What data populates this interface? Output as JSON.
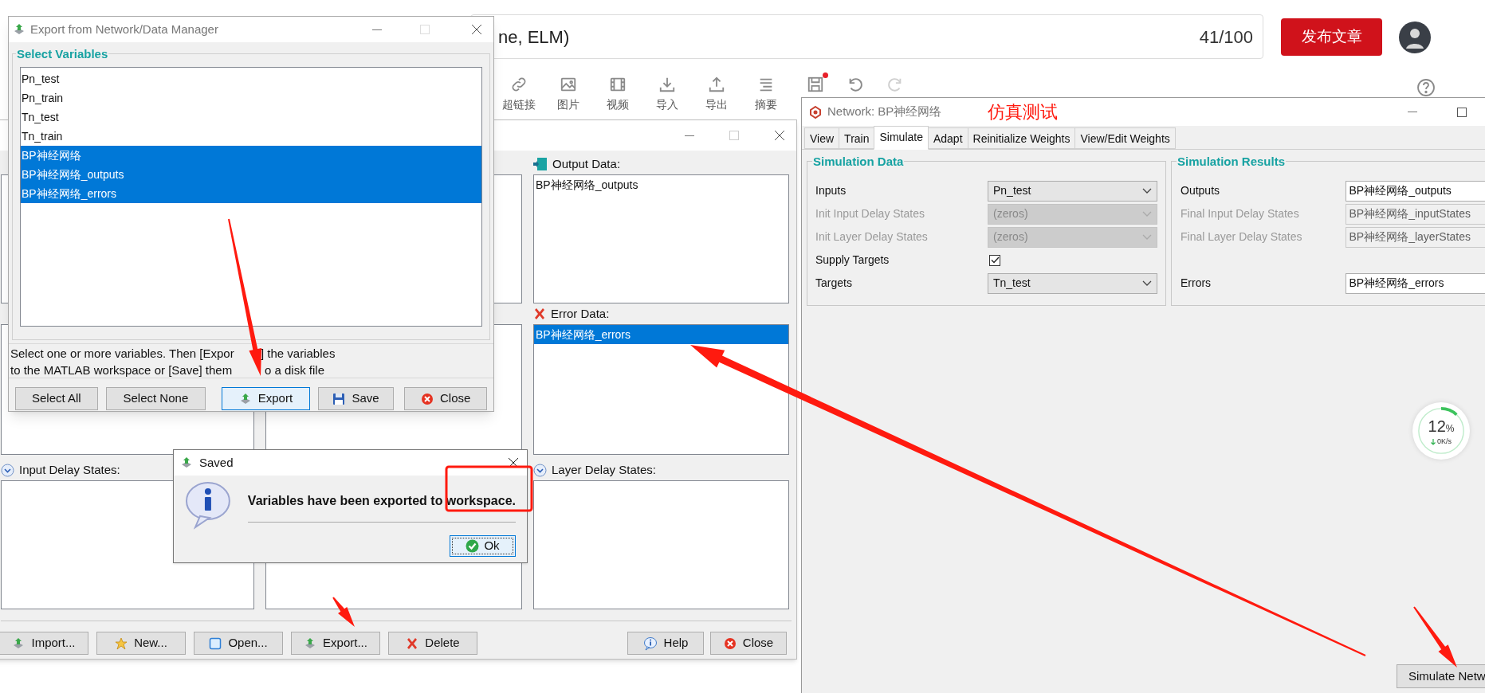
{
  "editor": {
    "title_text": "ne, ELM)",
    "counter": "41/100",
    "publish_button": "发布文章",
    "toolbar": [
      {
        "label": "超链接",
        "kind": "link"
      },
      {
        "label": "图片",
        "kind": "image"
      },
      {
        "label": "视频",
        "kind": "video"
      },
      {
        "label": "导入",
        "kind": "import"
      },
      {
        "label": "导出",
        "kind": "export"
      },
      {
        "label": "摘要",
        "kind": "summary"
      }
    ]
  },
  "manager": {
    "output_data": {
      "label": "Output Data:",
      "items": [
        {
          "text": "BP神经网络_outputs",
          "selected": false
        }
      ]
    },
    "error_data": {
      "label": "Error Data:",
      "items": [
        {
          "text": "BP神经网络_errors",
          "selected": true
        }
      ]
    },
    "input_delay_label": "Input Delay States:",
    "layer_delay_label": "Layer Delay States:",
    "buttons_left": [
      {
        "label": "Import...",
        "kind": "import"
      },
      {
        "label": "New...",
        "kind": "new"
      },
      {
        "label": "Open...",
        "kind": "open"
      },
      {
        "label": "Export...",
        "kind": "export"
      },
      {
        "label": "Delete",
        "kind": "delete"
      }
    ],
    "buttons_right": [
      {
        "label": "Help",
        "kind": "help"
      },
      {
        "label": "Close",
        "kind": "close"
      }
    ]
  },
  "export_dialog": {
    "title": "Export from Network/Data Manager",
    "group_title": "Select Variables",
    "variables": [
      {
        "name": "Pn_test",
        "selected": false
      },
      {
        "name": "Pn_train",
        "selected": false
      },
      {
        "name": "Tn_test",
        "selected": false
      },
      {
        "name": "Tn_train",
        "selected": false
      },
      {
        "name": "BP神经网络",
        "selected": true
      },
      {
        "name": "BP神经网络_outputs",
        "selected": true
      },
      {
        "name": "BP神经网络_errors",
        "selected": true
      }
    ],
    "hint_lines": [
      [
        "Select one or more variables. Then [Expor",
        "] the variables"
      ],
      [
        "to the MATLAB workspace or [Save] them",
        "o a disk file"
      ]
    ],
    "buttons": [
      {
        "label": "Select All",
        "kind": "plain",
        "focused": false
      },
      {
        "label": "Select None",
        "kind": "plain",
        "focused": false
      },
      {
        "label": "Export",
        "kind": "export",
        "focused": true
      },
      {
        "label": "Save",
        "kind": "save",
        "focused": false
      },
      {
        "label": "Close",
        "kind": "close",
        "focused": false
      }
    ]
  },
  "saved_dialog": {
    "title": "Saved",
    "message": "Variables have been exported to workspace.",
    "ok_button": "Ok"
  },
  "network_window": {
    "title": "Network: BP神经网络",
    "tabs": [
      {
        "label": "View",
        "selected": false
      },
      {
        "label": "Train",
        "selected": false
      },
      {
        "label": "Simulate",
        "selected": true
      },
      {
        "label": "Adapt",
        "selected": false
      },
      {
        "label": "Reinitialize Weights",
        "selected": false
      },
      {
        "label": "View/Edit Weights",
        "selected": false
      }
    ],
    "simulation_data": {
      "title": "Simulation Data",
      "rows": [
        {
          "kind": "combo",
          "label": "Inputs",
          "value": "Pn_test",
          "disabled": false
        },
        {
          "kind": "combo",
          "label": "Init Input Delay States",
          "value": "(zeros)",
          "disabled": true
        },
        {
          "kind": "combo",
          "label": "Init Layer Delay States",
          "value": "(zeros)",
          "disabled": true
        },
        {
          "kind": "checkbox",
          "label": "Supply Targets",
          "checked": true
        },
        {
          "kind": "combo",
          "label": "Targets",
          "value": "Tn_test",
          "disabled": false
        }
      ]
    },
    "simulation_results": {
      "title": "Simulation Results",
      "rows": [
        {
          "kind": "field",
          "label": "Outputs",
          "value": "BP神经网络_outputs",
          "disabled": false
        },
        {
          "kind": "field",
          "label": "Final Input Delay States",
          "value": "BP神经网络_inputStates",
          "disabled": true
        },
        {
          "kind": "field",
          "label": "Final Layer Delay States",
          "value": "BP神经网络_layerStates",
          "disabled": true
        },
        {
          "kind": "blank"
        },
        {
          "kind": "field",
          "label": "Errors",
          "value": "BP神经网络_errors",
          "disabled": false
        }
      ]
    },
    "simulate_button": "Simulate Netw"
  },
  "annotation": {
    "note": "仿真测试"
  },
  "speed_widget": {
    "percent": "12",
    "unit": "%",
    "rate": "0K/s",
    "level": 0.12
  }
}
